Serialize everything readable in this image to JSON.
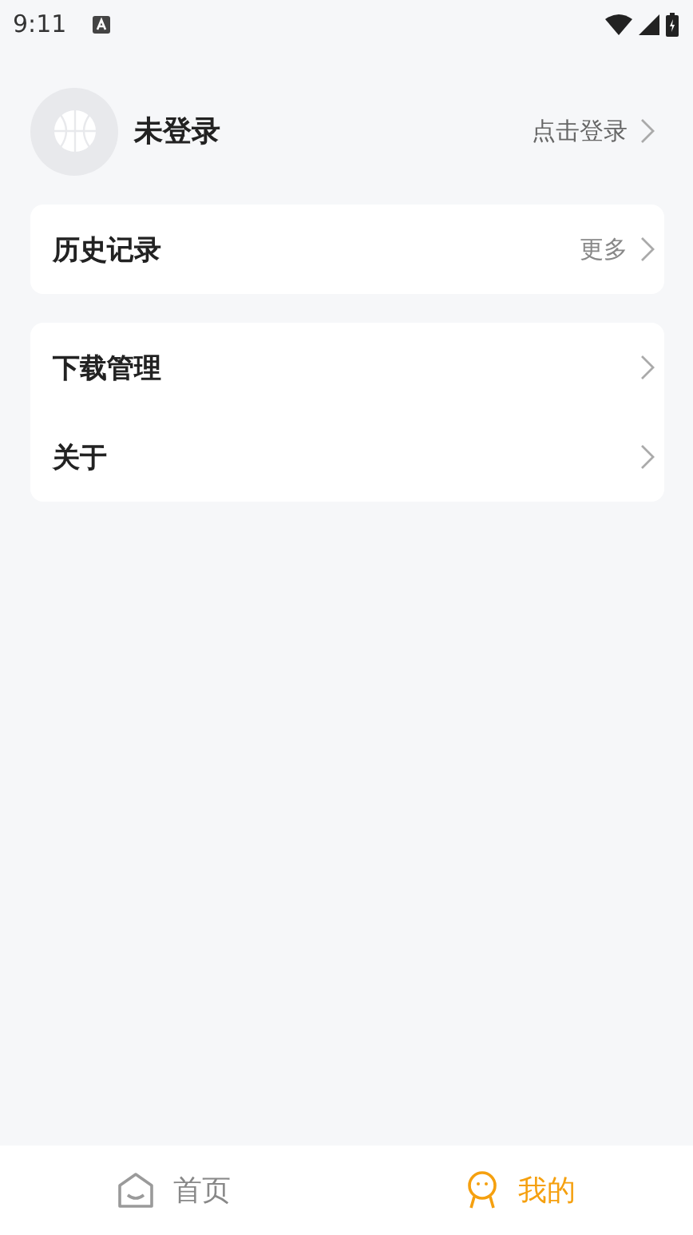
{
  "status_bar": {
    "time": "9:11"
  },
  "profile": {
    "name": "未登录",
    "action": "点击登录"
  },
  "groups": [
    {
      "items": [
        {
          "label": "历史记录",
          "trailing": "更多"
        }
      ]
    },
    {
      "items": [
        {
          "label": "下载管理"
        },
        {
          "label": "关于"
        }
      ]
    }
  ],
  "tabs": [
    {
      "kind": "home",
      "label": "首页",
      "selected": false
    },
    {
      "kind": "me",
      "label": "我的",
      "selected": true
    }
  ]
}
